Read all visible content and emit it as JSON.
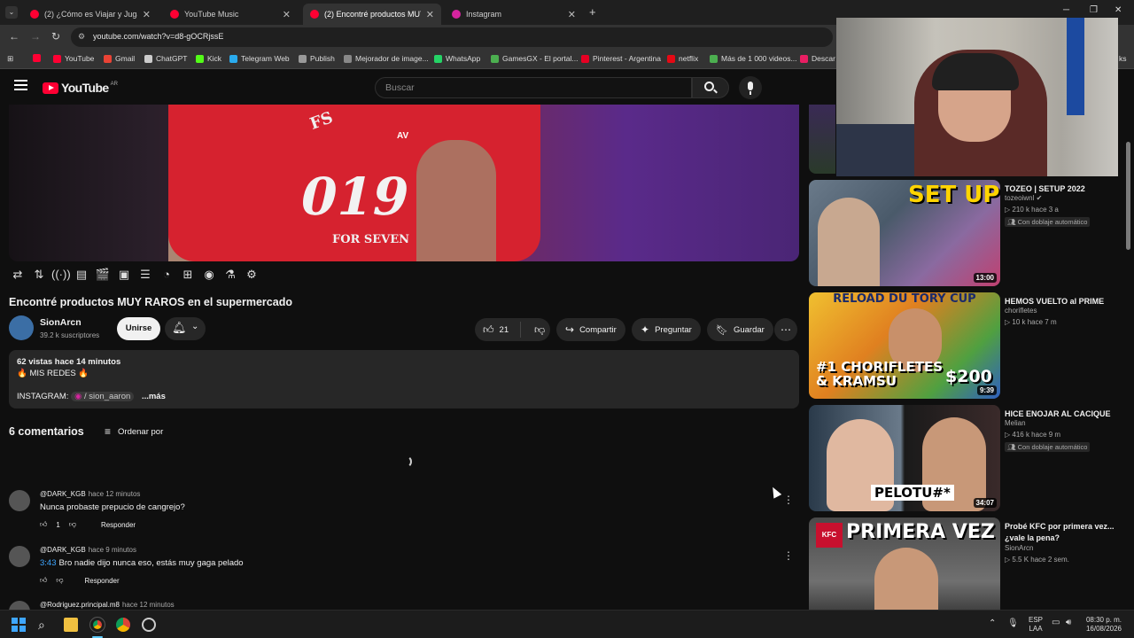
{
  "browser": {
    "tabs": [
      {
        "title": "(2) ¿Cómo es Viajar y Jugar a 0 ...",
        "favicon_color": "#ff0033"
      },
      {
        "title": "YouTube Music",
        "favicon_color": "#ff0033"
      },
      {
        "title": "(2) Encontré productos MUY RA...",
        "favicon_color": "#ff0033"
      },
      {
        "title": "Instagram",
        "favicon_color": "#d6249f"
      }
    ],
    "url": "youtube.com/watch?v=d8-gOCRjssE",
    "bookmarks": [
      {
        "label": "",
        "color": "#ff0033"
      },
      {
        "label": "YouTube",
        "color": "#ff0033"
      },
      {
        "label": "Gmail",
        "color": "#ea4335"
      },
      {
        "label": "ChatGPT",
        "color": "#cccccc"
      },
      {
        "label": "Kick",
        "color": "#53fc18"
      },
      {
        "label": "Telegram Web",
        "color": "#2aabee"
      },
      {
        "label": "Publish",
        "color": "#999999"
      },
      {
        "label": "Mejorador de image...",
        "color": "#888888"
      },
      {
        "label": "WhatsApp",
        "color": "#25d366"
      },
      {
        "label": "GamesGX - El portal...",
        "color": "#4caf50"
      },
      {
        "label": "Pinterest - Argentina",
        "color": "#e60023"
      },
      {
        "label": "netflix",
        "color": "#e50914"
      },
      {
        "label": "Más de 1 000 videos...",
        "color": "#4caf50"
      },
      {
        "label": "Descar",
        "color": "#e91e63"
      }
    ],
    "bookmarks_overflow": "ks"
  },
  "youtube": {
    "logo_text": "YouTube",
    "region": "AR",
    "search_placeholder": "Buscar"
  },
  "video": {
    "title": "Encontré productos MUY RAROS en el supermercado",
    "shirt_text_top": "FS",
    "shirt_text_main": "019",
    "shirt_text_bottom": "FOR SEVEN",
    "shirt_text_side": "AV",
    "channel": {
      "name": "SionArcn",
      "subscribers": "39.2 k suscriptores"
    },
    "join_label": "Unirse",
    "likes": "21",
    "actions": {
      "share": "Compartir",
      "ask": "Preguntar",
      "save": "Guardar"
    },
    "description": {
      "views_time": "62 vistas  hace 14 minutos",
      "redes": "🔥 MIS REDES 🔥",
      "instagram_label": "INSTAGRAM:",
      "instagram_handle": "/ sion_aaron",
      "more": "...más"
    }
  },
  "comments": {
    "count_label": "6 comentarios",
    "sort_label": "Ordenar por",
    "reply_label": "Responder",
    "items": [
      {
        "author": "@DARK_KGB",
        "time": "hace 12 minutos",
        "timestamp": "",
        "text": "Nunca probaste prepucio de cangrejo?",
        "likes": "1"
      },
      {
        "author": "@DARK_KGB",
        "time": "hace 9 minutos",
        "timestamp": "3:43",
        "text": "Bro nadie dijo nunca eso, estás muy gaga pelado",
        "likes": ""
      },
      {
        "author": "@Rodriguez.principal.m8",
        "time": "hace 12 minutos",
        "timestamp": "",
        "text": "",
        "likes": ""
      }
    ]
  },
  "sidebar": [
    {
      "title": "TOZEO | SETUP 2022",
      "channel": "tozeoiwnl",
      "verified": true,
      "meta": "210 k  hace 3 a",
      "dub": "Con doblaje automático",
      "duration": "13:00",
      "thumb_text": "SET UP"
    },
    {
      "title": "HEMOS VUELTO al PRIME",
      "channel": "chorifletes",
      "verified": false,
      "meta": "10 k  hace 7 m",
      "dub": "",
      "duration": "9:39",
      "thumb_text": "#1 CHORIFLETES & KRAMSU",
      "thumb_text2": "$200",
      "thumb_text3": "RELOAD DU TORY CUP"
    },
    {
      "title": "HICE ENOJAR AL CACIQUE",
      "channel": "Melian",
      "verified": false,
      "meta": "416 k  hace 9 m",
      "dub": "Con doblaje automático",
      "duration": "34:07",
      "thumb_text": "PELOTU#*"
    },
    {
      "title": "Probé KFC por primera vez... ¿vale la pena?",
      "channel": "SionArcn",
      "verified": false,
      "meta": "5.5 K  hace 2 sem.",
      "dub": "",
      "duration": "",
      "thumb_text": "PRIMERA VEZ",
      "thumb_text2": "KFC"
    }
  ],
  "taskbar": {
    "lang_line1": "ESP",
    "lang_line2": "LAA",
    "time": "08:30 p. m.",
    "date": "16/08/2026"
  }
}
